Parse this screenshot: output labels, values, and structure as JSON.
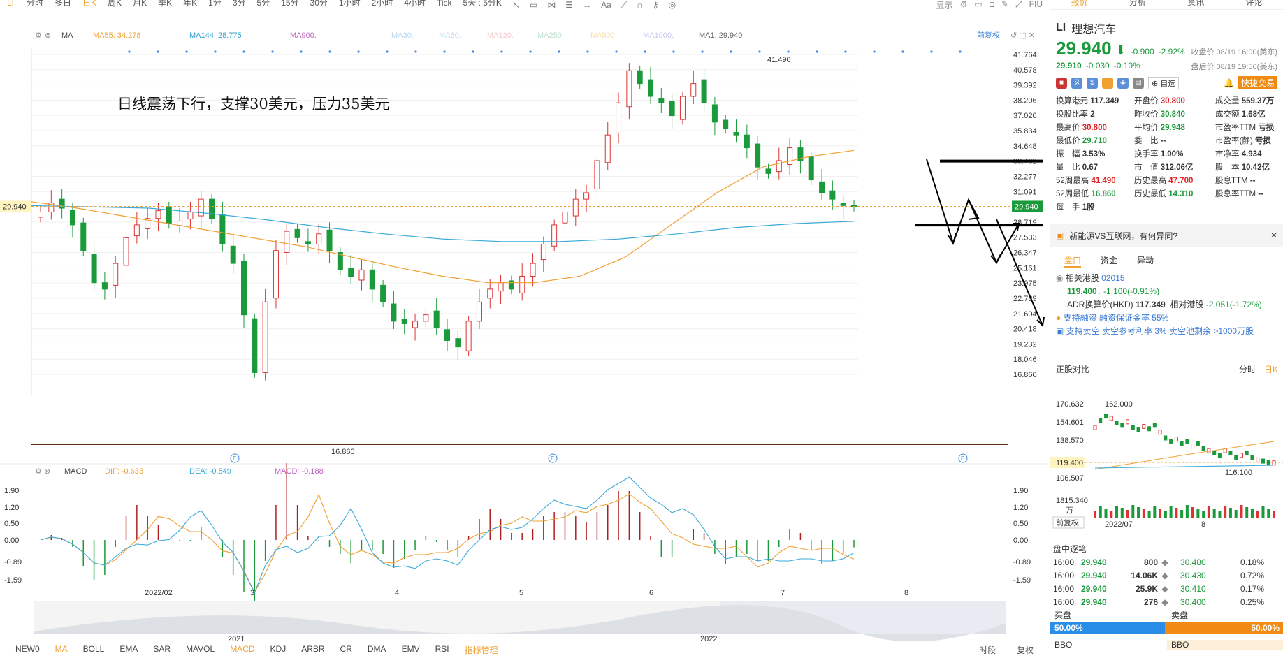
{
  "toolbar": {
    "symbol": "LI",
    "periods": [
      "分时",
      "多日",
      "日K",
      "周K",
      "月K",
      "季K",
      "年K",
      "1分",
      "3分",
      "5分",
      "15分",
      "30分",
      "1小时",
      "2小时",
      "4小时",
      "Tick",
      "5天 : 5分K"
    ],
    "active_period": "日K",
    "display_label": "显示",
    "fiu_label": "FIU"
  },
  "chart": {
    "ma_bar": {
      "label": "MA",
      "items": [
        {
          "text": "MA55: 34.278",
          "color": "#f0a030"
        },
        {
          "text": "MA144: 28.775",
          "color": "#30a0d0"
        },
        {
          "text": "MA900:",
          "color": "#c060c0"
        },
        {
          "text": "MA30:",
          "color": "#bcd8f0"
        },
        {
          "text": "MA60:",
          "color": "#bce0ec"
        },
        {
          "text": "MA120:",
          "color": "#f8c8c8"
        },
        {
          "text": "MA250:",
          "color": "#c0e0d0"
        },
        {
          "text": "MA500:",
          "color": "#f8e0a0"
        },
        {
          "text": "MA1000:",
          "color": "#c0c8f0"
        },
        {
          "text": "MA1: 29.940",
          "color": "#666666"
        }
      ],
      "fq": "前复权"
    },
    "annotation": "日线震荡下行，支撑30美元，压力35美元",
    "y_labels": [
      "41.764",
      "40.578",
      "39.392",
      "38.206",
      "37.020",
      "35.834",
      "34.648",
      "33.462",
      "32.277",
      "31.091",
      "29.905",
      "28.719",
      "27.533",
      "26.347",
      "25.161",
      "23.975",
      "22.789",
      "21.604",
      "20.418",
      "19.232",
      "18.046",
      "16.860"
    ],
    "current_price_label": "29.940",
    "high_label": "41.490",
    "low_label": "16.860",
    "macd_bar": {
      "label": "MACD",
      "dif": "DIF: -0.633",
      "dea": "DEA: -0.549",
      "macd": "MACD: -0.188"
    },
    "macd_y_labels": [
      "1.90",
      "1.20",
      "0.50",
      "0.00",
      "-0.89",
      "-1.59"
    ],
    "x_labels": [
      "2022/02",
      "3",
      "4",
      "5",
      "6",
      "7",
      "8"
    ],
    "year_labels": [
      "2021",
      "2022"
    ]
  },
  "chart_data": {
    "type": "candlestick",
    "title": "",
    "ylim": [
      16.86,
      41.764
    ],
    "approx_close_path": [
      29.5,
      30.2,
      29.8,
      28.5,
      26.5,
      24.0,
      23.5,
      25.5,
      27.5,
      28.5,
      29.0,
      29.6,
      28.6,
      28.8,
      29.5,
      30.5,
      29.0,
      27.0,
      25.5,
      21.5,
      17.0,
      22.5,
      26.5,
      28.0,
      27.5,
      27.0,
      27.8,
      26.5,
      25.0,
      24.5,
      25.0,
      23.5,
      22.5,
      21.0,
      20.8,
      21.0,
      21.5,
      20.5,
      19.5,
      19.0,
      21.0,
      22.5,
      23.5,
      24.0,
      23.5,
      24.5,
      25.5,
      27.0,
      28.5,
      29.5,
      30.5,
      31.0,
      33.5,
      35.5,
      38.0,
      40.5,
      39.5,
      38.5,
      38.0,
      37.0,
      38.5,
      39.5,
      38.0,
      36.5,
      36.0,
      35.5,
      34.5,
      33.0,
      32.5,
      33.5,
      34.5,
      33.5,
      32.0,
      31.0,
      30.5,
      30.0,
      29.94
    ],
    "ma55_approx": [
      30.3,
      29.8,
      29.2,
      28.6,
      28.0,
      27.4,
      26.8,
      26.0,
      25.2,
      24.5,
      24.0,
      24.0,
      24.5,
      26.0,
      28.5,
      31.0,
      33.0,
      33.8,
      34.3
    ],
    "ma144_approx": [
      30.0,
      29.9,
      29.8,
      29.4,
      28.9,
      28.3,
      27.8,
      27.4,
      27.2,
      27.2,
      27.4,
      27.8,
      28.3,
      28.6,
      28.78
    ],
    "support": 29.905,
    "resistance": 33.462
  },
  "right_panel": {
    "tabs": [
      "报价",
      "分析",
      "资讯",
      "评论"
    ],
    "active_tab": "报价",
    "symbol": "LI",
    "name": "理想汽车",
    "price": "29.940",
    "arrow": "⬇",
    "change": "-0.900",
    "change_pct": "-2.92%",
    "close_info": "收盘价 08/19 16:00(美东)",
    "after_price": "29.910",
    "after_change": "-0.030",
    "after_pct": "-0.10%",
    "after_info": "盘后价 08/19 19:56(美东)",
    "watch_label": "自选",
    "quick_trade": "快捷交易",
    "quote": [
      [
        "换算港元",
        "117.349",
        "开盘价",
        "30.800",
        "成交量",
        "559.37万"
      ],
      [
        "换股比率",
        "2",
        "昨收价",
        "30.840",
        "成交额",
        "1.68亿"
      ],
      [
        "最高价",
        "30.800",
        "平均价",
        "29.948",
        "市盈率TTM",
        "亏损"
      ],
      [
        "最低价",
        "29.710",
        "委　比",
        "--",
        "市盈率(静)",
        "亏损"
      ],
      [
        "振　幅",
        "3.53%",
        "换手率",
        "1.00%",
        "市净率",
        "4.934"
      ],
      [
        "量　比",
        "0.67",
        "市　值",
        "312.06亿",
        "股　本",
        "10.42亿"
      ],
      [
        "52周最高",
        "41.490",
        "历史最高",
        "47.700",
        "股息TTM",
        "--"
      ],
      [
        "52周最低",
        "16.860",
        "历史最低",
        "14.310",
        "股息率TTM",
        "--"
      ],
      [
        "每　手",
        "1股",
        "",
        "",
        "",
        ""
      ]
    ],
    "banner": "新能源VS互联网，有何异同?",
    "subtabs": [
      "盘口",
      "资金",
      "异动"
    ],
    "hk_label": "相关港股",
    "hk_code": "02015",
    "hk_price": "119.400",
    "hk_change": "-1.100(-0.91%)",
    "adr_label": "ADR换算价(HKD)",
    "adr_value": "117.349",
    "relative_label": "相对港股",
    "relative_value": "-2.051(-1.72%)",
    "margin_text": "支持融资",
    "margin_link": "融资保证金率 55%",
    "short_text": "支持卖空",
    "short_link": "卖空参考利率 3%  卖空池剩余 >1000万股",
    "compare_title": "正股对比",
    "compare_tabs": [
      "分时",
      "日K"
    ],
    "mini": {
      "y_labels": [
        "170.632",
        "154.601",
        "138.570",
        "119.400",
        "106.507"
      ],
      "high": "162.000",
      "low": "116.100",
      "vol": "1815.340",
      "vol_unit": "万",
      "fq": "前复权",
      "x_labels": [
        "2022/07",
        "8"
      ]
    },
    "trades_title": "盘中逐笔",
    "trades": [
      [
        "16:00",
        "29.940",
        "800",
        "30.480",
        "0.18%"
      ],
      [
        "16:00",
        "29.940",
        "14.06K",
        "30.430",
        "0.72%"
      ],
      [
        "16:00",
        "29.940",
        "25.9K",
        "30.410",
        "0.17%"
      ],
      [
        "16:00",
        "29.940",
        "276",
        "30.400",
        "0.25%"
      ]
    ],
    "buy_label": "买盘",
    "sell_label": "卖盘",
    "buy_pct": "50.00%",
    "sell_pct": "50.00%",
    "bbo": "BBO"
  },
  "bottom": {
    "indicators": [
      "NEW0",
      "MA",
      "BOLL",
      "EMA",
      "SAR",
      "MAVOL",
      "MACD",
      "KDJ",
      "ARBR",
      "CR",
      "DMA",
      "EMV",
      "RSI",
      "指标管理"
    ],
    "active": [
      "MA",
      "MACD",
      "指标管理"
    ],
    "right": [
      "时段",
      "复权"
    ]
  }
}
